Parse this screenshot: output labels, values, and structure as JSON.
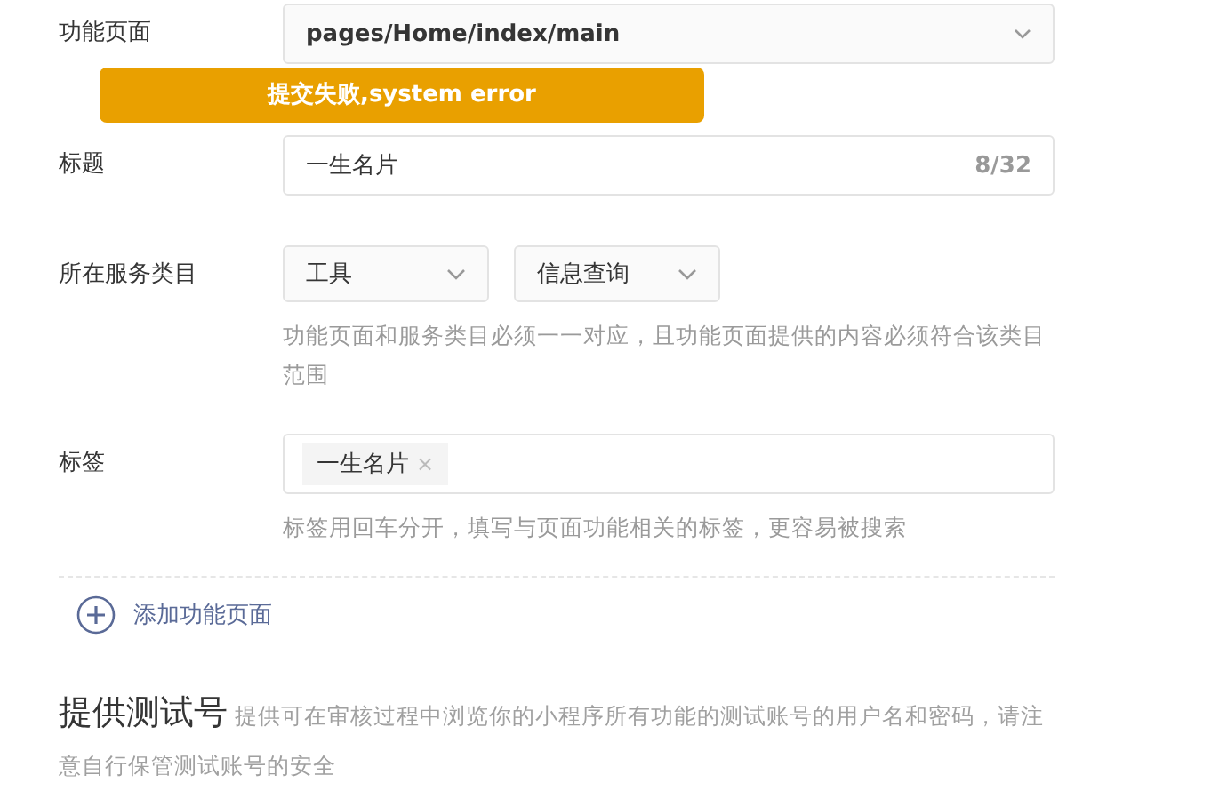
{
  "toast": {
    "text": "提交失败,system error"
  },
  "form": {
    "page_row": {
      "label": "功能页面",
      "value": "pages/Home/index/main"
    },
    "title_row": {
      "label": "标题",
      "value": "一生名片",
      "counter": "8/32"
    },
    "category_row": {
      "label": "所在服务类目",
      "selects": [
        {
          "value": "工具"
        },
        {
          "value": "信息查询"
        }
      ],
      "hint": "功能页面和服务类目必须一一对应，且功能页面提供的内容必须符合该类目范围"
    },
    "tags_row": {
      "label": "标签",
      "tags": [
        {
          "text": "一生名片",
          "remove": "×"
        }
      ],
      "hint": "标签用回车分开，填写与页面功能相关的标签，更容易被搜索"
    },
    "add_page": {
      "label": "添加功能页面"
    }
  },
  "test_account": {
    "heading": "提供测试号",
    "description": "提供可在审核过程中浏览你的小程序所有功能的测试账号的用户名和密码，请注意自行保管测试账号的安全"
  }
}
